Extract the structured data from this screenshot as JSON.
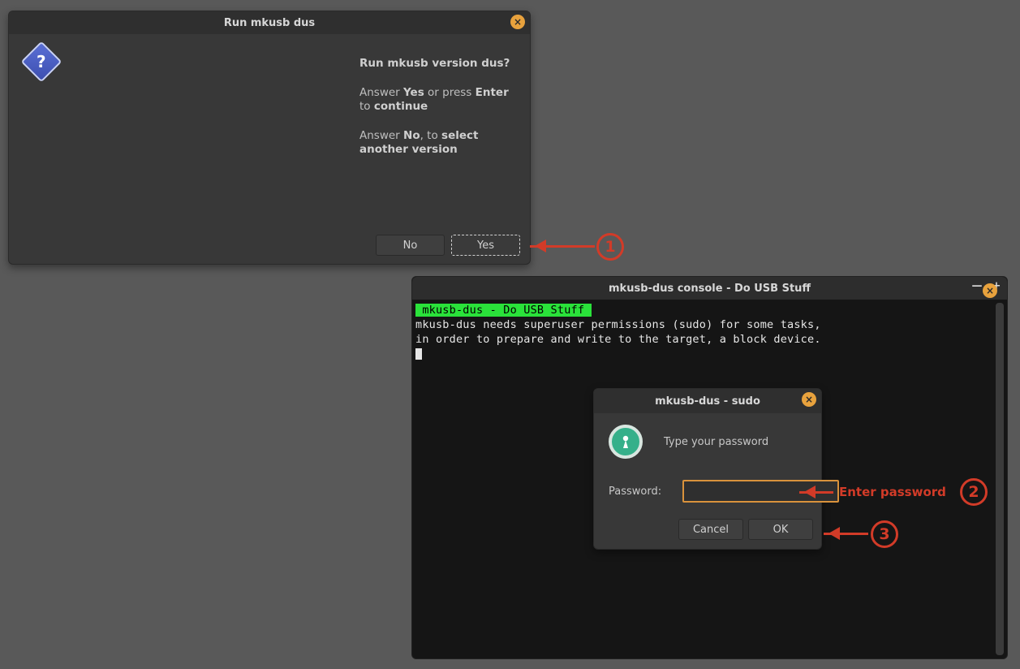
{
  "dialog1": {
    "title": "Run mkusb dus",
    "question": "Run mkusb version dus?",
    "line2_pre": "Answer ",
    "line2_yes": "Yes",
    "line2_mid": " or press ",
    "line2_enter": "Enter",
    "line2_to": " to ",
    "line2_cont": "continue",
    "line3_pre": "Answer ",
    "line3_no": "No",
    "line3_mid": ", to ",
    "line3_tail": "select another version",
    "no_btn": "No",
    "yes_btn": "Yes"
  },
  "console": {
    "title": "mkusb-dus console - Do USB Stuff",
    "banner": " mkusb-dus - Do USB Stuff ",
    "line1": "mkusb-dus needs superuser permissions (sudo) for some tasks,",
    "line2": "in order to prepare and write to the target, a block device."
  },
  "pwdlg": {
    "title": "mkusb-dus - sudo",
    "prompt": "Type your password",
    "label": "Password:",
    "cancel": "Cancel",
    "ok": "OK"
  },
  "annotations": {
    "step1": "1",
    "step2": "2",
    "step3": "3",
    "enter_password": "Enter password"
  }
}
